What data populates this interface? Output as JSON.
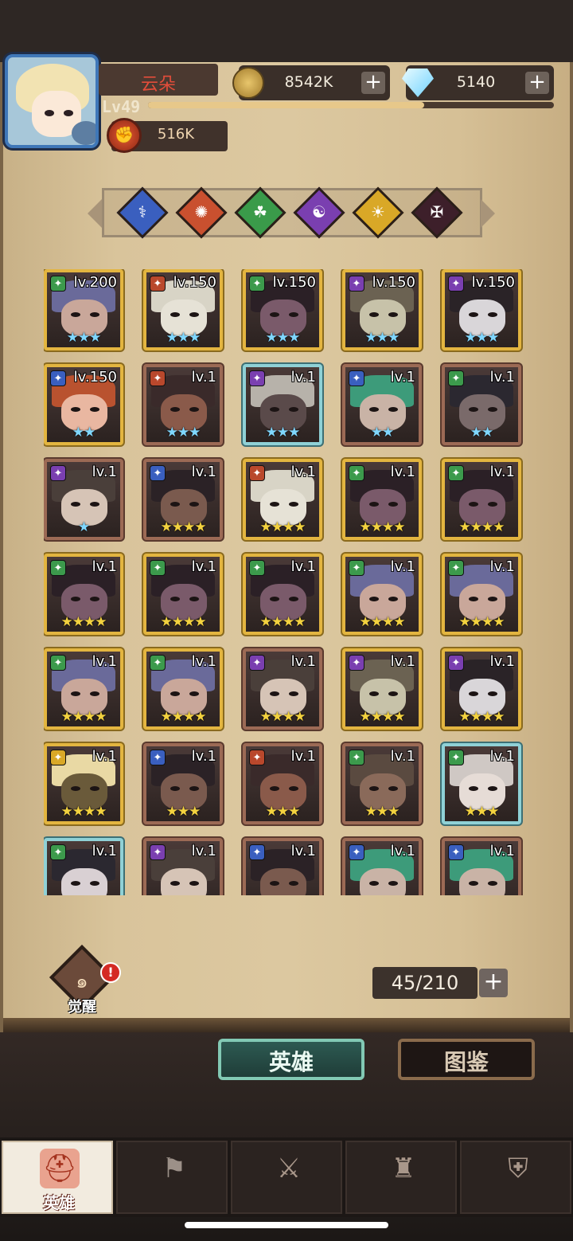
{
  "player": {
    "name": "云朵",
    "level": "Lv49",
    "power": "516K",
    "xp_fraction": 0.68
  },
  "resources": {
    "gold": "8542K",
    "gems": "5140"
  },
  "element_filters": [
    {
      "name": "water-element",
      "color": "#3a5fbf",
      "symbol": "⚕"
    },
    {
      "name": "fire-element",
      "color": "#c9502f",
      "symbol": "✺"
    },
    {
      "name": "nature-element",
      "color": "#3a9b4a",
      "symbol": "☘"
    },
    {
      "name": "shadow-element",
      "color": "#7a3fb0",
      "symbol": "☯"
    },
    {
      "name": "light-element",
      "color": "#d9a827",
      "symbol": "☀"
    },
    {
      "name": "dark-element",
      "color": "#3d1f2a",
      "symbol": "✠"
    }
  ],
  "heroes": [
    {
      "level": "lv.200",
      "stars": 3,
      "frame": "gold",
      "class_color": "#3c9a4c",
      "hair": "#6a6a9a",
      "skin": "#c9a79a",
      "star_color": "#7fd7ff"
    },
    {
      "level": "lv.150",
      "stars": 3,
      "frame": "gold",
      "class_color": "#b9482c",
      "hair": "#d8d4c6",
      "skin": "#e6e2d6",
      "star_color": "#7fd7ff"
    },
    {
      "level": "lv.150",
      "stars": 3,
      "frame": "gold",
      "class_color": "#3c9a4c",
      "hair": "#2b2026",
      "skin": "#7a5a6a",
      "star_color": "#7fd7ff"
    },
    {
      "level": "lv.150",
      "stars": 3,
      "frame": "gold",
      "class_color": "#7a3fb0",
      "hair": "#6b6252",
      "skin": "#c7c2a9",
      "star_color": "#7fd7ff"
    },
    {
      "level": "lv.150",
      "stars": 3,
      "frame": "gold",
      "class_color": "#7a3fb0",
      "hair": "#2a2327",
      "skin": "#d9d6d9",
      "star_color": "#7fd7ff"
    },
    {
      "level": "lv.150",
      "stars": 2,
      "frame": "gold",
      "class_color": "#3a5fbf",
      "hair": "#b9522f",
      "skin": "#e9b7a1",
      "star_color": "#7fd7ff"
    },
    {
      "level": "lv.1",
      "stars": 3,
      "frame": "bronze",
      "class_color": "#b9482c",
      "hair": "#3a2a2a",
      "skin": "#8a5a4a",
      "star_color": "#7fd7ff"
    },
    {
      "level": "lv.1",
      "stars": 3,
      "frame": "cyan",
      "class_color": "#7a3fb0",
      "hair": "#b7b2aa",
      "skin": "#5a4a4a",
      "star_color": "#7fd7ff"
    },
    {
      "level": "lv.1",
      "stars": 2,
      "frame": "bronze",
      "class_color": "#3a5fbf",
      "hair": "#3d9b7a",
      "skin": "#c9b3a6",
      "star_color": "#7fd7ff"
    },
    {
      "level": "lv.1",
      "stars": 2,
      "frame": "bronze",
      "class_color": "#3c9a4c",
      "hair": "#2b2830",
      "skin": "#7a6a6a",
      "star_color": "#7fd7ff"
    },
    {
      "level": "lv.1",
      "stars": 1,
      "frame": "bronze",
      "class_color": "#7a3fb0",
      "hair": "#4a3f3a",
      "skin": "#d6c4b6",
      "star_color": "#7fd7ff"
    },
    {
      "level": "lv.1",
      "stars": 4,
      "frame": "bronze",
      "class_color": "#3a5fbf",
      "hair": "#2b2226",
      "skin": "#7a5a4e",
      "star_color": "#f3d23f"
    },
    {
      "level": "lv.1",
      "stars": 4,
      "frame": "gold",
      "class_color": "#b9482c",
      "hair": "#d8d4c6",
      "skin": "#e6e2d6",
      "star_color": "#f3d23f"
    },
    {
      "level": "lv.1",
      "stars": 4,
      "frame": "gold",
      "class_color": "#3c9a4c",
      "hair": "#2b2026",
      "skin": "#7a5a6a",
      "star_color": "#f3d23f"
    },
    {
      "level": "lv.1",
      "stars": 4,
      "frame": "gold",
      "class_color": "#3c9a4c",
      "hair": "#2b2026",
      "skin": "#7a5a6a",
      "star_color": "#f3d23f"
    },
    {
      "level": "lv.1",
      "stars": 4,
      "frame": "gold",
      "class_color": "#3c9a4c",
      "hair": "#2b2026",
      "skin": "#7a5a6a",
      "star_color": "#f3d23f"
    },
    {
      "level": "lv.1",
      "stars": 4,
      "frame": "gold",
      "class_color": "#3c9a4c",
      "hair": "#2b2026",
      "skin": "#7a5a6a",
      "star_color": "#f3d23f"
    },
    {
      "level": "lv.1",
      "stars": 4,
      "frame": "gold",
      "class_color": "#3c9a4c",
      "hair": "#2b2026",
      "skin": "#7a5a6a",
      "star_color": "#f3d23f"
    },
    {
      "level": "lv.1",
      "stars": 4,
      "frame": "gold",
      "class_color": "#3c9a4c",
      "hair": "#6a6a9a",
      "skin": "#c9a79a",
      "star_color": "#f3d23f"
    },
    {
      "level": "lv.1",
      "stars": 4,
      "frame": "gold",
      "class_color": "#3c9a4c",
      "hair": "#6a6a9a",
      "skin": "#c9a79a",
      "star_color": "#f3d23f"
    },
    {
      "level": "lv.1",
      "stars": 4,
      "frame": "gold",
      "class_color": "#3c9a4c",
      "hair": "#6a6a9a",
      "skin": "#c9a79a",
      "star_color": "#f3d23f"
    },
    {
      "level": "lv.1",
      "stars": 4,
      "frame": "gold",
      "class_color": "#3c9a4c",
      "hair": "#6a6a9a",
      "skin": "#c9a79a",
      "star_color": "#f3d23f"
    },
    {
      "level": "lv.1",
      "stars": 4,
      "frame": "bronze",
      "class_color": "#7a3fb0",
      "hair": "#4a3f3a",
      "skin": "#d6c4b6",
      "star_color": "#f3d23f"
    },
    {
      "level": "lv.1",
      "stars": 4,
      "frame": "gold",
      "class_color": "#7a3fb0",
      "hair": "#6b6252",
      "skin": "#c7c2a9",
      "star_color": "#f3d23f"
    },
    {
      "level": "lv.1",
      "stars": 4,
      "frame": "gold",
      "class_color": "#7a3fb0",
      "hair": "#2a2327",
      "skin": "#d9d6d9",
      "star_color": "#f3d23f"
    },
    {
      "level": "lv.1",
      "stars": 4,
      "frame": "gold",
      "class_color": "#d9a827",
      "hair": "#e9d9a4",
      "skin": "#6a5a3a",
      "star_color": "#f3d23f"
    },
    {
      "level": "lv.1",
      "stars": 3,
      "frame": "bronze",
      "class_color": "#3a5fbf",
      "hair": "#2b2226",
      "skin": "#7a5a4e",
      "star_color": "#f3d23f"
    },
    {
      "level": "lv.1",
      "stars": 3,
      "frame": "bronze",
      "class_color": "#b9482c",
      "hair": "#3a2a2a",
      "skin": "#8a5a4a",
      "star_color": "#f3d23f"
    },
    {
      "level": "lv.1",
      "stars": 3,
      "frame": "bronze",
      "class_color": "#3c9a4c",
      "hair": "#5a4a40",
      "skin": "#8a6a5a",
      "star_color": "#f3d23f"
    },
    {
      "level": "lv.1",
      "stars": 3,
      "frame": "cyan",
      "class_color": "#3c9a4c",
      "hair": "#cfc8c4",
      "skin": "#e6dcd6",
      "star_color": "#f3d23f"
    },
    {
      "level": "lv.1",
      "stars": 0,
      "frame": "cyan",
      "class_color": "#3c9a4c",
      "hair": "#2b2830",
      "skin": "#d9d0d3",
      "star_color": "#f3d23f"
    },
    {
      "level": "lv.1",
      "stars": 0,
      "frame": "bronze",
      "class_color": "#7a3fb0",
      "hair": "#4a3f3a",
      "skin": "#d6c4b6",
      "star_color": "#f3d23f"
    },
    {
      "level": "lv.1",
      "stars": 0,
      "frame": "bronze",
      "class_color": "#3a5fbf",
      "hair": "#2b2226",
      "skin": "#7a5a4e",
      "star_color": "#f3d23f"
    },
    {
      "level": "lv.1",
      "stars": 0,
      "frame": "bronze",
      "class_color": "#3a5fbf",
      "hair": "#3d9b7a",
      "skin": "#c9b3a6",
      "star_color": "#f3d23f"
    },
    {
      "level": "lv.1",
      "stars": 0,
      "frame": "bronze",
      "class_color": "#3a5fbf",
      "hair": "#3d9b7a",
      "skin": "#c9b3a6",
      "star_color": "#f3d23f"
    }
  ],
  "awaken": {
    "label": "觉醒",
    "alert": "!"
  },
  "capacity": "45/210",
  "tabs": {
    "heroes": "英雄",
    "codex": "图鉴"
  },
  "nav": {
    "heroes_label": "英雄"
  }
}
